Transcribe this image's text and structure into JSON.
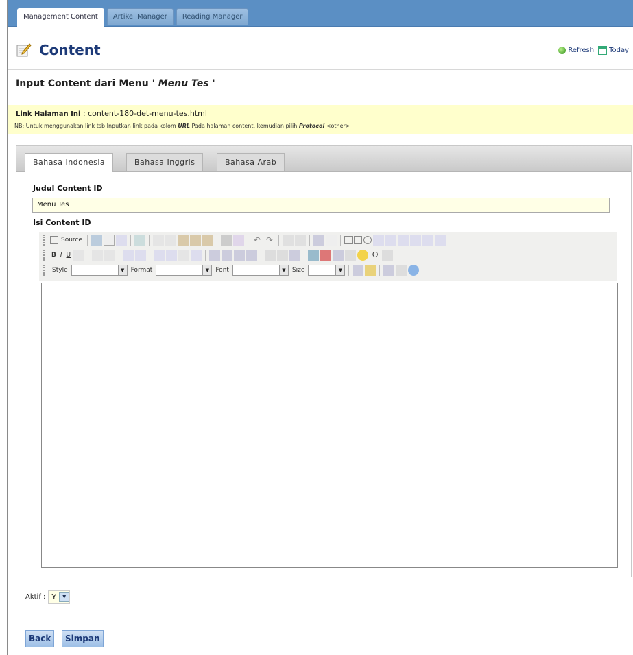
{
  "tabs": [
    {
      "label": "Management Content",
      "active": true
    },
    {
      "label": "Artikel Manager",
      "active": false
    },
    {
      "label": "Reading Manager",
      "active": false
    }
  ],
  "header": {
    "title": "Content",
    "refresh_label": "Refresh",
    "today_label": "Today"
  },
  "subtitle": {
    "prefix": "Input Content dari Menu ",
    "menu_name": "' Menu Tes '"
  },
  "info": {
    "link_label": "Link Halaman Ini",
    "link_value": "content-180-det-menu-tes.html",
    "note_prefix": "NB: Untuk menggunakan link tsb Inputkan link pada kolom ",
    "note_url": "URL",
    "note_mid": " Pada halaman content, kemudian pilih ",
    "note_protocol": "Protocol",
    "note_suffix": " <other>"
  },
  "lang_tabs": [
    {
      "label": "Bahasa Indonesia",
      "active": true
    },
    {
      "label": "Bahasa Inggris",
      "active": false
    },
    {
      "label": "Bahasa Arab",
      "active": false
    }
  ],
  "form": {
    "title_label": "Judul Content ID",
    "title_value": "Menu Tes",
    "content_label": "Isi Content ID"
  },
  "editor": {
    "source_label": "Source",
    "style_label": "Style",
    "format_label": "Format",
    "font_label": "Font",
    "size_label": "Size",
    "bold": "B",
    "italic": "I",
    "underline": "U"
  },
  "aktif": {
    "label": "Aktif :",
    "value": "Y"
  },
  "buttons": {
    "back": "Back",
    "save": "Simpan"
  },
  "colors": {
    "topbar": "#5b8fc4",
    "title": "#1d3a78",
    "info_bg": "#ffffcc",
    "input_bg": "#ffffe6"
  }
}
